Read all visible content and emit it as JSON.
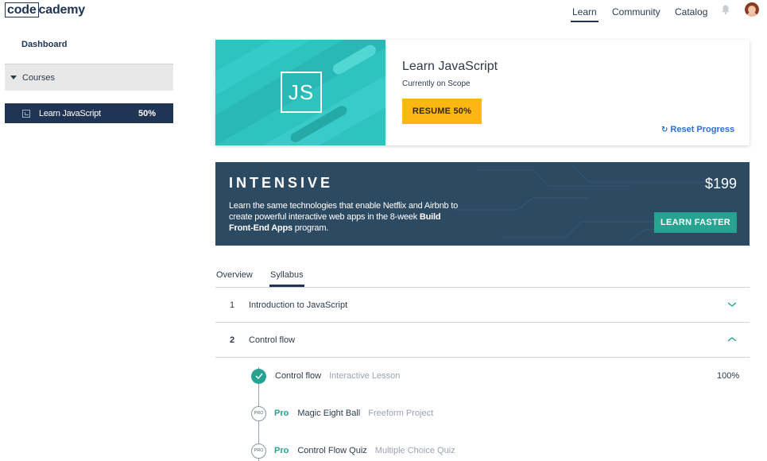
{
  "topnav": {
    "logo_boxed": "code",
    "logo_rest": "cademy",
    "links": [
      "Learn",
      "Community",
      "Catalog"
    ],
    "active": "Learn"
  },
  "sidebar": {
    "dashboard": "Dashboard",
    "courses_label": "Courses",
    "course": {
      "name": "Learn JavaScript",
      "progress": "50%"
    }
  },
  "course_card": {
    "art_text": "JS",
    "title": "Learn JavaScript",
    "subtitle": "Currently on Scope",
    "resume_label": "RESUME 50%",
    "reset_label": "Reset Progress"
  },
  "intensive": {
    "title": "INTENSIVE",
    "desc_before": "Learn the same technologies that enable Netflix and Airbnb to create powerful interactive web apps in the 8-week ",
    "desc_bold": "Build Front-End Apps",
    "desc_after": " program.",
    "price": "$199",
    "cta_label": "LEARN FASTER"
  },
  "tabs": {
    "overview": "Overview",
    "syllabus": "Syllabus",
    "active": "Syllabus"
  },
  "syllabus": {
    "units": [
      {
        "num": "1",
        "name": "Introduction to JavaScript",
        "expanded": false
      },
      {
        "num": "2",
        "name": "Control flow",
        "expanded": true
      }
    ],
    "lessons": [
      {
        "name": "Control flow",
        "type": "Interactive Lesson",
        "status": "done",
        "progress": "100%"
      },
      {
        "badge": "PRO",
        "pro_label": "Pro",
        "name": "Magic Eight Ball",
        "type": "Freeform Project"
      },
      {
        "badge": "PRO",
        "pro_label": "Pro",
        "name": "Control Flow Quiz",
        "type": "Multiple Choice Quiz"
      }
    ]
  },
  "colors": {
    "navy": "#203553",
    "teal": "#27a392",
    "yellow": "#fdb712",
    "link_blue": "#2a6fd6",
    "banner_bg": "#2d4a63"
  }
}
